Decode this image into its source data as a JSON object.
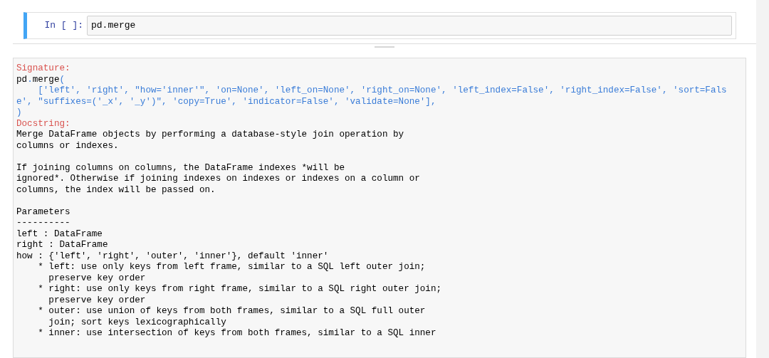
{
  "cell": {
    "prompt": "In [ ]:",
    "code": "pd.merge"
  },
  "pager": {
    "signature_label": "Signature:",
    "signature_lines": [
      {
        "segments": [
          {
            "text": "pd",
            "kind": "name"
          },
          {
            "text": ".",
            "kind": "operator"
          },
          {
            "text": "merge",
            "kind": "name"
          },
          {
            "text": "(",
            "kind": "operator"
          }
        ]
      },
      {
        "segments": [
          {
            "text": "    ['left', 'right', \"how='inner'\", 'on=None', 'left_on=None', 'right_on=None', 'left_index=False', 'right_index=False', 'sort=Fals",
            "kind": "operator"
          }
        ]
      },
      {
        "segments": [
          {
            "text": "e', \"suffixes=('_x', '_y')\", 'copy=True', 'indicator=False', 'validate=None'],",
            "kind": "operator"
          }
        ]
      },
      {
        "segments": [
          {
            "text": ")",
            "kind": "operator"
          }
        ]
      }
    ],
    "docstring_label": "Docstring:",
    "docstring_blocks": [
      {
        "lines": [
          "Merge DataFrame objects by performing a database-style join operation by",
          "columns or indexes."
        ]
      },
      {
        "lines": [
          "If joining columns on columns, the DataFrame indexes *will be",
          "ignored*. Otherwise if joining indexes on indexes or indexes on a column or",
          "columns, the index will be passed on."
        ]
      },
      {
        "lines": [
          "Parameters",
          "----------",
          "left : DataFrame",
          "right : DataFrame",
          "how : {'left', 'right', 'outer', 'inner'}, default 'inner'",
          "    * left: use only keys from left frame, similar to a SQL left outer join;",
          "      preserve key order",
          "    * right: use only keys from right frame, similar to a SQL right outer join;",
          "      preserve key order",
          "    * outer: use union of keys from both frames, similar to a SQL full outer",
          "      join; sort keys lexicographically",
          "    * inner: use intersection of keys from both frames, similar to a SQL inner"
        ]
      }
    ]
  }
}
